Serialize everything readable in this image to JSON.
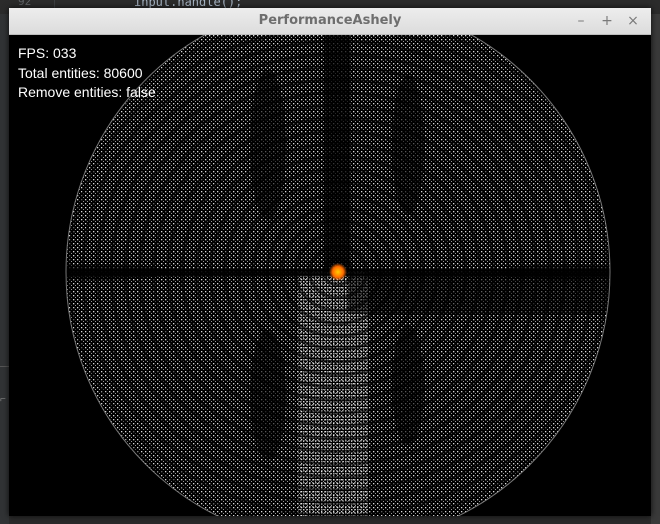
{
  "ide": {
    "line_number": "92",
    "code_line": "input.handle();"
  },
  "window": {
    "title": "PerformanceAshely",
    "controls": {
      "minimize": "–",
      "maximize": "+",
      "close": "×"
    }
  },
  "hud": {
    "fps_label": "FPS: 033",
    "entities_label": "Total entities: 80600",
    "remove_label": "Remove entities: false"
  },
  "scene": {
    "background_color": "#000000",
    "particle_color": "#ffffff",
    "accent_color": "#ffcc00",
    "center_glow_color": "#ff6a00"
  }
}
